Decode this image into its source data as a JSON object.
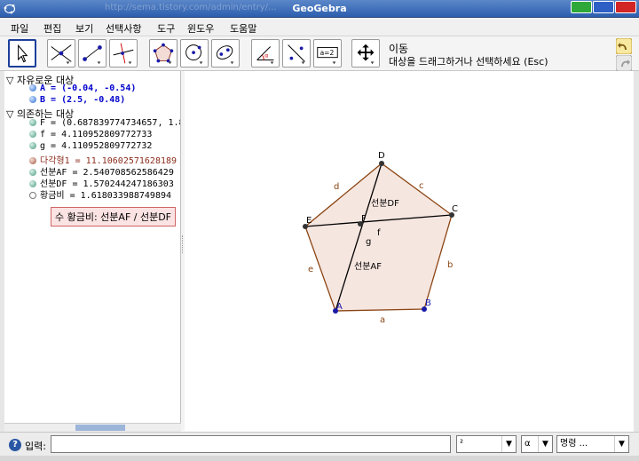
{
  "window": {
    "title": "GeoGebra",
    "ghost_url": "http://sema.tistory.com/admin/entry/...",
    "colors": {
      "titlebar": "#3b6bbd",
      "win_green": "#2fa83a",
      "win_blue": "#2e5fc4",
      "win_red": "#d22525"
    }
  },
  "menu": [
    "파일",
    "편집",
    "보기",
    "선택사항",
    "도구",
    "윈도우",
    "도움말"
  ],
  "toolbar": {
    "tools": [
      "move-icon",
      "intersect-lines-icon",
      "segment-icon",
      "perpendicular-icon",
      "polygon-icon",
      "circle-icon",
      "conic-icon",
      "angle-icon",
      "reflect-icon",
      "text-icon",
      "move-view-icon"
    ],
    "tool_name": "이동",
    "tool_help": "대상을 드래그하거나 선택하세요 (Esc)",
    "text_tool_label": "a=2"
  },
  "algebra": {
    "free_header": "자유로운 대상",
    "free": [
      {
        "text": "A = (-0.04, -0.54)",
        "color": "#0000cc"
      },
      {
        "text": "B = (2.5, -0.48)",
        "color": "#0000cc"
      }
    ],
    "dependent_header": "의존하는 대상",
    "dependent": [
      {
        "text": "F = (0.687839774734657, 1.894",
        "color": "#000000"
      },
      {
        "text": "f = 4.110952809772733",
        "color": "#000000"
      },
      {
        "text": "g = 4.110952809772732",
        "color": "#000000"
      },
      {
        "text": "다각형1 = 11.10602571628189",
        "color": "#8b2d1d"
      },
      {
        "text": "선분AF = 2.540708562586429",
        "color": "#000000"
      },
      {
        "text": "선분DF = 1.570244247186303",
        "color": "#000000"
      },
      {
        "text": "황금비 = 1.618033988749894",
        "color": "#000000"
      }
    ],
    "tooltip": "수 황금비: 선분AF / 선분DF"
  },
  "geometry": {
    "points": {
      "A": "A",
      "B": "B",
      "C": "C",
      "D": "D",
      "E": "E",
      "F": "F"
    },
    "segments": {
      "a": "a",
      "b": "b",
      "c": "c",
      "d": "d",
      "e": "e",
      "f": "f",
      "g": "g"
    },
    "seg_af": "선분AF",
    "seg_df": "선분DF",
    "colors": {
      "polygon_fill": "#f6e6e0",
      "edge": "#8b4513",
      "point_blue": "#1a1aa8"
    }
  },
  "inputbar": {
    "label": "입력:",
    "value": "",
    "combo1": "²",
    "combo2": "α",
    "combo3": "명령 ..."
  }
}
